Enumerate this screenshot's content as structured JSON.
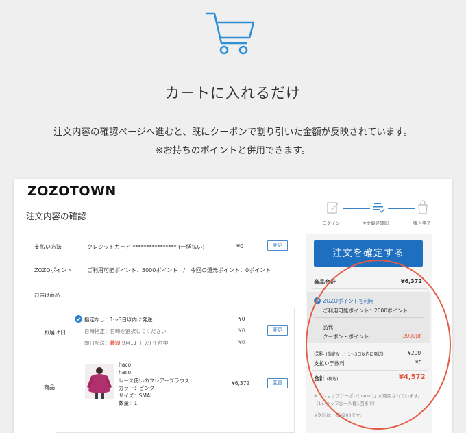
{
  "hero": {
    "icon": "shopping-cart-icon",
    "title": "カートに入れるだけ",
    "line1": "注文内容の確認ページへ進むと、既にクーポンで割り引いた金額が反映されています。",
    "line2": "※お持ちのポイントと併用できます。"
  },
  "shot": {
    "logo": "ZOZOTOWN",
    "title": "注文内容の確認",
    "steps": [
      "ログイン",
      "注文最終確認",
      "購入完了"
    ],
    "payment": {
      "label": "支払い方法",
      "value": "クレジットカード **************** (一括払い)",
      "price": "¥0",
      "button": "変更"
    },
    "points": {
      "label": "ZOZOポイント",
      "value": "ご利用可能ポイント：5000ポイント　/　今回の還元ポイント：0ポイント"
    },
    "delivery": {
      "section": "お届け商品",
      "date_label": "お届け日",
      "option1": "指定なし：1〜3日以内に発送",
      "option2": "日時指定：日時を選択してください",
      "option3_prefix": "即日配送：",
      "option3_tag": "最短",
      "option3_suffix": " 9月11日(火) 午前中",
      "prices": [
        "¥0",
        "¥0",
        "¥0"
      ],
      "button": "変更"
    },
    "product": {
      "label": "商品",
      "brand1": "haco!",
      "brand2": "haco!",
      "name": "レース使いのフレアーブラウス",
      "color": "カラー：ピンク",
      "size": "サイズ：SMALL",
      "qty": "数量：1",
      "price": "¥6,372",
      "button": "変更"
    },
    "summary": {
      "confirm": "注文を確定する",
      "subtotal_label": "商品合計",
      "subtotal": "¥6,372",
      "use_points": "ZOZOポイントを利用",
      "available": "ご利用可能ポイント：2000ポイント",
      "discount_title": "品代",
      "discount_label": "クーポン・ポイント",
      "discount": "-2000pt",
      "shipping_label": "送料",
      "shipping_note": "(指定なし：1〜3日以内に発送)",
      "shipping": "¥200",
      "fee_label": "支払い手数料",
      "fee": "¥0",
      "total_label": "合計",
      "total_note": "(税込)",
      "total": "¥4,572",
      "note1": "※「ショップクーポン[haco!]」が適用されています。",
      "note2": "（1ショップお一人様1回まで）",
      "note3": "※送料は一律¥200です。"
    }
  },
  "colors": {
    "accent": "#1f6fc0",
    "red": "#e8523c",
    "background": "#efefef"
  }
}
